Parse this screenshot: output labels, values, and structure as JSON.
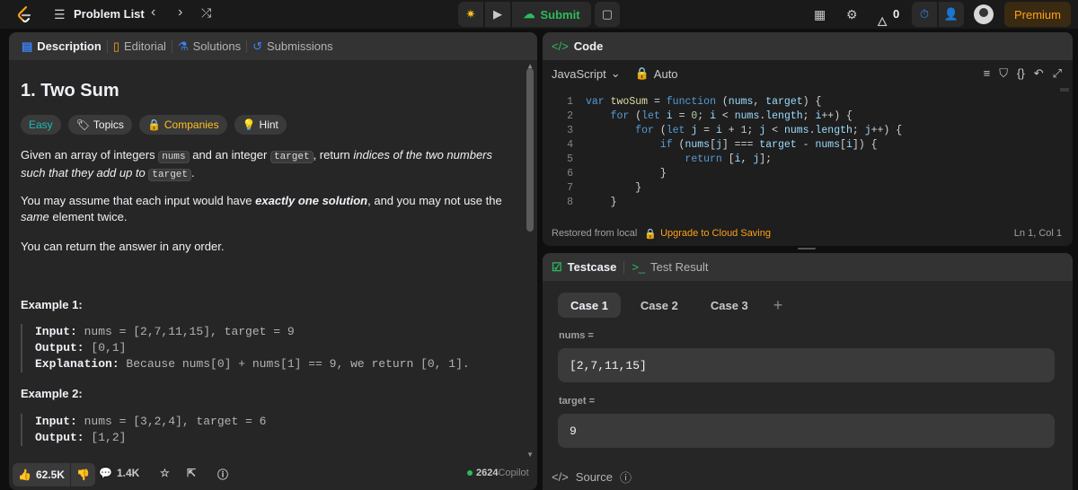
{
  "topbar": {
    "title": "Problem List",
    "submit_label": "Submit",
    "streak": "0",
    "premium_label": "Premium",
    "icons": [
      "logo-icon",
      "list-icon",
      "chevron-left-icon",
      "chevron-right-icon",
      "shuffle-icon",
      "debug-icon",
      "play-icon",
      "cloud-upload-icon",
      "note-icon",
      "layout-icon",
      "settings-icon",
      "fire-icon",
      "timer-icon",
      "add-user-icon",
      "avatar"
    ],
    "accent_submit": "#2cbb5d",
    "accent_premium": "#ffa116"
  },
  "left_tabs": [
    {
      "label": "Description",
      "icon": "description-icon"
    },
    {
      "label": "Editorial",
      "icon": "book-icon"
    },
    {
      "label": "Solutions",
      "icon": "flask-icon"
    },
    {
      "label": "Submissions",
      "icon": "history-icon"
    }
  ],
  "problem": {
    "title": "1. Two Sum",
    "difficulty": "Easy",
    "chips": {
      "topics": "Topics",
      "companies": "Companies",
      "hint": "Hint"
    },
    "p1": {
      "a": "Given an array of integers ",
      "nums": "nums",
      "b": " and an integer ",
      "target": "target",
      "c": ", return ",
      "d": "indices of the two numbers such that they add up to ",
      "target2": "target",
      "e": "."
    },
    "p2": {
      "a": "You may assume that each input would have ",
      "b": "exactly one solution",
      "c": ", and you may not use the ",
      "d": "same",
      "e": " element twice."
    },
    "p3": "You can return the answer in any order.",
    "examples": [
      {
        "title": "Example 1:",
        "input_label": "Input:",
        "input": " nums = [2,7,11,15], target = 9",
        "output_label": "Output:",
        "output": " [0,1]",
        "explanation_label": "Explanation:",
        "explanation": " Because nums[0] + nums[1] == 9, we return [0, 1]."
      },
      {
        "title": "Example 2:",
        "input_label": "Input:",
        "input": " nums = [3,2,4], target = 6",
        "output_label": "Output:",
        "output": " [1,2]"
      }
    ]
  },
  "left_footer": {
    "likes": "62.5K",
    "comments": "1.4K",
    "online": "2624",
    "copilot": "Copilot"
  },
  "code": {
    "header": "Code",
    "language": "JavaScript",
    "mode": "Auto",
    "lines": [
      {
        "n": "1",
        "html": "<span class=\"kw\">var</span> <span class=\"fn\">twoSum</span> = <span class=\"kw\">function</span> (<span class=\"vr\">nums</span>, <span class=\"vr\">target</span>) {"
      },
      {
        "n": "2",
        "html": "    <span class=\"kw\">for</span> (<span class=\"kw\">let</span> <span class=\"vr\">i</span> = <span class=\"nm\">0</span>; <span class=\"vr\">i</span> &lt; <span class=\"vr\">nums</span>.<span class=\"vr\">length</span>; <span class=\"vr\">i</span>++) {"
      },
      {
        "n": "3",
        "html": "        <span class=\"kw\">for</span> (<span class=\"kw\">let</span> <span class=\"vr\">j</span> = <span class=\"vr\">i</span> + <span class=\"nm\">1</span>; <span class=\"vr\">j</span> &lt; <span class=\"vr\">nums</span>.<span class=\"vr\">length</span>; <span class=\"vr\">j</span>++) {"
      },
      {
        "n": "4",
        "html": "            <span class=\"kw\">if</span> (<span class=\"vr\">nums</span>[<span class=\"vr\">j</span>] === <span class=\"vr\">target</span> - <span class=\"vr\">nums</span>[<span class=\"vr\">i</span>]) {"
      },
      {
        "n": "5",
        "html": "                <span class=\"kw\">return</span> [<span class=\"vr\">i</span>, <span class=\"vr\">j</span>];"
      },
      {
        "n": "6",
        "html": "            }"
      },
      {
        "n": "7",
        "html": "        }"
      },
      {
        "n": "8",
        "html": "    }"
      }
    ],
    "restored": "Restored from local",
    "upgrade": "Upgrade to Cloud Saving",
    "cursor": "Ln 1, Col 1"
  },
  "testcase": {
    "tab_testcase": "Testcase",
    "tab_result": "Test Result",
    "cases": [
      "Case 1",
      "Case 2",
      "Case 3"
    ],
    "nums_label": "nums =",
    "nums_value": "[2,7,11,15]",
    "target_label": "target =",
    "target_value": "9",
    "source_label": "Source"
  }
}
